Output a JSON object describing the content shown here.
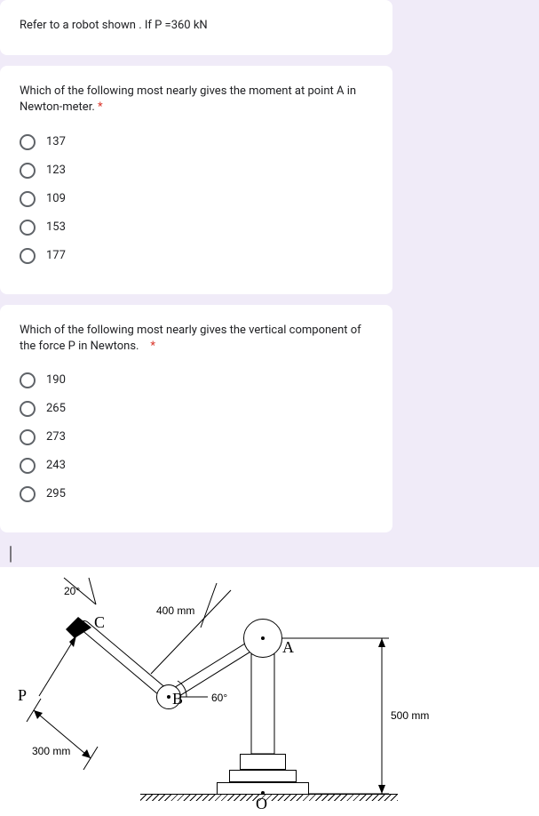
{
  "card0": {
    "prompt": "Refer to a robot shown . If P =360 kN"
  },
  "card1": {
    "prompt": "Which of the following most nearly gives the moment at point A in Newton-meter.",
    "required": "*",
    "options": [
      "137",
      "123",
      "109",
      "153",
      "177"
    ]
  },
  "card2": {
    "prompt": "Which of the following most nearly gives the vertical component of the force P in Newtons.",
    "required": "*",
    "options": [
      "190",
      "265",
      "273",
      "243",
      "295"
    ]
  },
  "figure": {
    "angle1": "20°",
    "angle2": "60°",
    "dim1": "400 mm",
    "dim2": "300 mm",
    "dim3": "500 mm",
    "P": "P",
    "A": "A",
    "B": "B",
    "C": "C",
    "O": "O"
  }
}
